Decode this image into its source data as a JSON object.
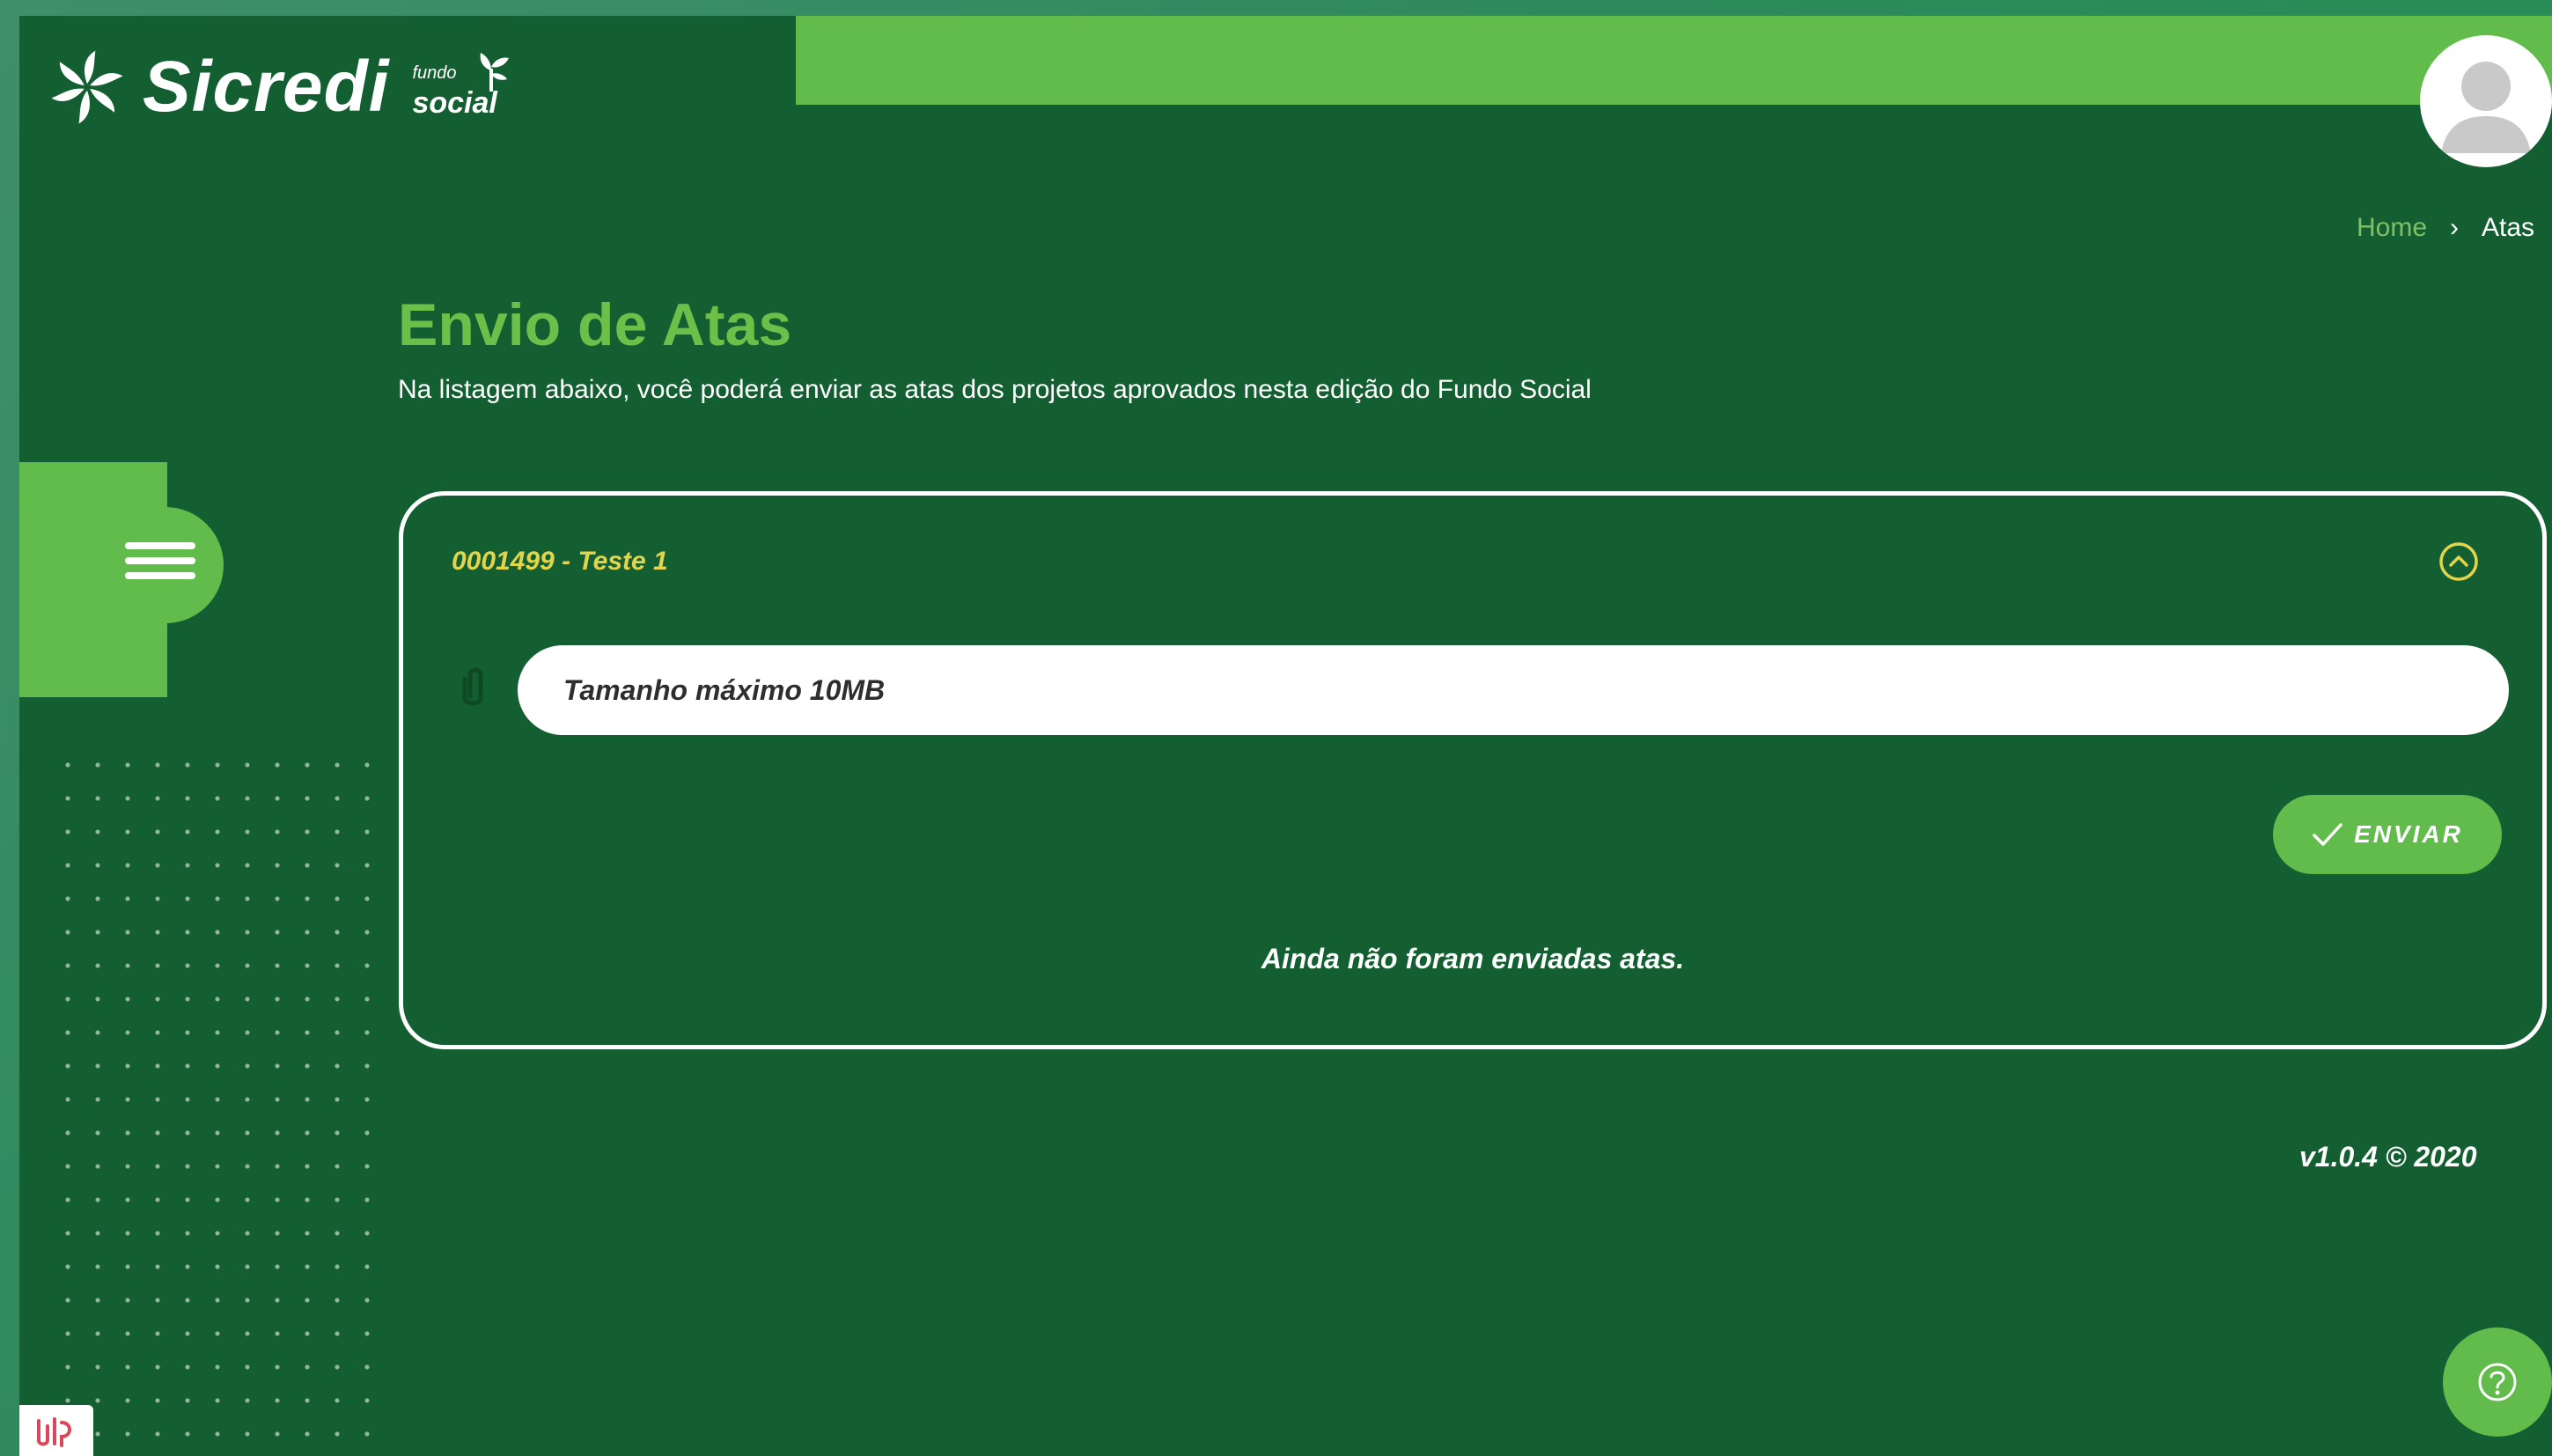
{
  "brand": {
    "name": "Sicredi",
    "sub_line1": "fundo",
    "sub_line2": "social"
  },
  "breadcrumb": {
    "home": "Home",
    "separator": "›",
    "current": "Atas"
  },
  "page": {
    "title": "Envio de Atas",
    "description": "Na listagem abaixo, você poderá enviar as atas dos projetos aprovados nesta edição do Fundo Social"
  },
  "project": {
    "header": "0001499 - Teste 1",
    "file_input_placeholder": "Tamanho máximo 10MB",
    "send_label": "ENVIAR",
    "empty_message": "Ainda não foram enviadas atas."
  },
  "footer": {
    "version": "v1.0.4 © 2020"
  },
  "icons": {
    "logo": "sicredi-logo-icon",
    "avatar": "user-avatar-icon",
    "menu": "hamburger-menu-icon",
    "collapse": "chevron-up-circle-icon",
    "attach": "paperclip-icon",
    "send": "checkmark-icon",
    "help": "question-circle-icon"
  },
  "colors": {
    "background": "#135f31",
    "accent": "#61bc4b",
    "title": "#6cc04a",
    "project_header": "#e2d44b",
    "text": "#ffffff"
  }
}
